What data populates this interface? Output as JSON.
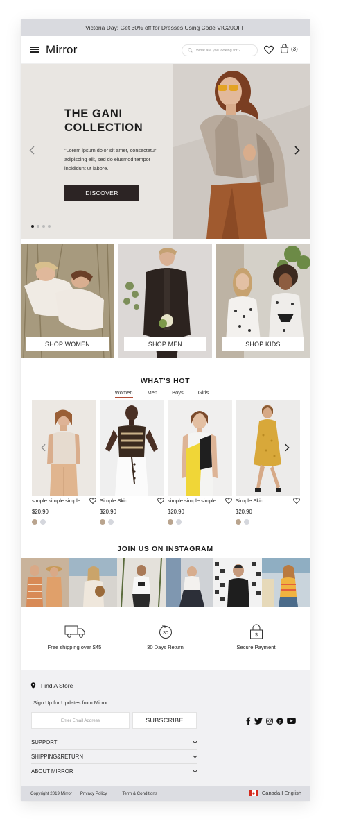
{
  "promo": {
    "text": "Victoria Day: Get 30% off for Dresses Using Code VIC20OFF"
  },
  "header": {
    "logo": "Mirror",
    "search_placeholder": "What are you looking for ?",
    "cart_count": "(3)",
    "icons": [
      "menu-icon",
      "search-icon",
      "heart-icon",
      "shopping-bag-icon"
    ]
  },
  "hero": {
    "title_line1": "THE GANI",
    "title_line2": "COLLECTION",
    "text": "\"Lorem ipsum dolor sit amet, consectetur adipiscing elit, sed do eiusmod tempor incididunt ut labore.",
    "button": "DISCOVER",
    "slides": 4,
    "active_slide": 1
  },
  "categories": [
    {
      "label": "SHOP WOMEN"
    },
    {
      "label": "SHOP MEN"
    },
    {
      "label": "SHOP KIDS"
    }
  ],
  "hot": {
    "title": "WHAT'S HOT",
    "tabs": [
      "Women",
      "Men",
      "Boys",
      "Girls"
    ],
    "active_tab": "Women",
    "products": [
      {
        "name": "simple simple simple",
        "price": "$20.90",
        "swatches": [
          "#b9a48e",
          "#d5d7dd"
        ]
      },
      {
        "name": "Simple Skirt",
        "price": "$20.90",
        "swatches": [
          "#b9a48e",
          "#d5d7dd"
        ]
      },
      {
        "name": "simple simple simple",
        "price": "$20.90",
        "swatches": [
          "#b9a48e",
          "#d5d7dd"
        ]
      },
      {
        "name": "Simple Skirt",
        "price": "$20.90",
        "swatches": [
          "#b9a48e",
          "#d5d7dd"
        ]
      }
    ]
  },
  "instagram": {
    "title": "JOIN US ON INSTAGRAM",
    "tiles": 6
  },
  "features": [
    {
      "icon": "truck-icon",
      "label": "Free shipping over $45"
    },
    {
      "icon": "return-30-icon",
      "label": "30 Days Return"
    },
    {
      "icon": "lock-dollar-icon",
      "label": "Secure Payment"
    }
  ],
  "footer": {
    "find_store": "Find A Store",
    "signup": "Sign Up for Updates from Mirror",
    "email_placeholder": "Enter Email Address",
    "subscribe": "SUBSCRIBE",
    "social": [
      "facebook-icon",
      "twitter-icon",
      "instagram-icon",
      "pinterest-icon",
      "youtube-icon"
    ],
    "accordion": [
      "SUPPORT",
      "SHIPPING&RETURN",
      "ABOUT MIRROR"
    ],
    "copyright": "Copyright 2019 Mirror",
    "privacy": "Privacy Policy",
    "terms": "Term & Conditions",
    "locale": "Canada I English"
  },
  "colors": {
    "promo_bg": "#d9dadf",
    "button_dark": "#2c2424",
    "tab_underline": "#b24d36",
    "footer_bg": "#f1f1f3",
    "bottom_bar": "#dcdde2"
  }
}
